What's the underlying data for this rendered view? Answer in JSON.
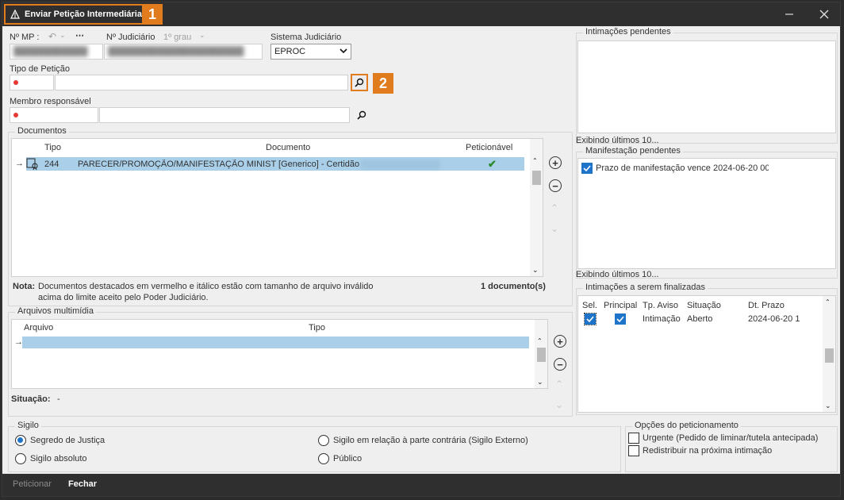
{
  "window": {
    "title": "Enviar Petição Intermediária",
    "annotation_1": "1",
    "annotation_2": "2"
  },
  "form": {
    "mp_label": "Nº MP :",
    "mp_value": "████████████",
    "judiciario_label": "Nº Judiciário",
    "grau_label": "1º grau",
    "judiciario_value": "██████████████████████",
    "sistema_label": "Sistema Judiciário",
    "sistema_value": "EPROC",
    "tipo_peticao_label": "Tipo de Petição",
    "membro_label": "Membro responsável"
  },
  "documentos": {
    "group_title": "Documentos",
    "columns": [
      "Tipo",
      "Documento",
      "Peticionável"
    ],
    "rows": [
      {
        "tipo": "244",
        "documento": "PARECER/PROMOÇÃO/MANIFESTAÇÃO MINIST [Generico] - Certidão",
        "peticionavel": "✔"
      }
    ],
    "nota_label": "Nota:",
    "nota_text_1": "Documentos destacados em vermelho e itálico estão com tamanho de arquivo inválido",
    "nota_text_2": "acima do limite aceito pelo Poder Judiciário.",
    "count": "1 documento(s)"
  },
  "multimidia": {
    "group_title": "Arquivos multimídia",
    "columns": [
      "Arquivo",
      "Tipo"
    ],
    "situacao_label": "Situação:",
    "situacao_value": "-"
  },
  "intimacoes_pendentes": {
    "title": "Intimações pendentes",
    "footer": "Exibindo últimos 10..."
  },
  "manifestacao_pendentes": {
    "title": "Manifestação pendentes",
    "item": "Prazo de manifestação vence 2024-06-20 00",
    "footer": "Exibindo últimos 10..."
  },
  "intimacoes_finalizar": {
    "title": "Intimações a serem finalizadas",
    "columns": [
      "Sel.",
      "Principal",
      "Tp. Aviso",
      "Situação",
      "Dt. Prazo"
    ],
    "rows": [
      {
        "tp_aviso": "Intimação",
        "situacao": "Aberto",
        "dt_prazo": "2024-06-20 1"
      }
    ]
  },
  "sigilo": {
    "title": "Sigilo",
    "options": [
      "Segredo de Justiça",
      "Sigilo absoluto",
      "Sigilo em relação à parte contrária (Sigilo Externo)",
      "Público"
    ],
    "selected": "Segredo de Justiça"
  },
  "opcoes": {
    "title": "Opções do peticionamento",
    "urgente": "Urgente (Pedido de liminar/tutela antecipada)",
    "redistribuir": "Redistribuir na próxima intimação"
  },
  "bottom": {
    "peticionar": "Peticionar",
    "fechar": "Fechar"
  },
  "colors": {
    "accent": "#e07b1e",
    "selection": "#a9cfe9",
    "check": "#1e74c9"
  }
}
